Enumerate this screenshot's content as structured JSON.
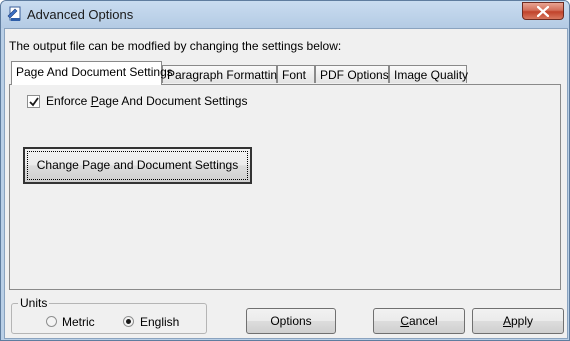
{
  "window": {
    "title": "Advanced Options",
    "icon": "app-document-icon",
    "close_icon": "close-icon"
  },
  "intro_text": "The output file can be modfied by changing the settings below:",
  "tabs": [
    {
      "label": "Page And Document Settings",
      "active": true
    },
    {
      "label": "Paragraph Formatting",
      "active": false
    },
    {
      "label": "Font",
      "active": false
    },
    {
      "label": "PDF Options",
      "active": false
    },
    {
      "label": "Image Quality",
      "active": false
    }
  ],
  "page_settings": {
    "enforce_label_pre": "Enforce ",
    "enforce_label_mnemonic": "P",
    "enforce_label_post": "age And Document Settings",
    "enforce_checked": true,
    "change_button_label": "Change Page and Document Settings"
  },
  "units": {
    "legend": "Units",
    "metric_label": "Metric",
    "english_label": "English",
    "selected": "English"
  },
  "buttons": {
    "options": "Options",
    "cancel_mnemonic": "C",
    "cancel_rest": "ancel",
    "apply_mnemonic": "A",
    "apply_rest": "pply"
  },
  "colors": {
    "title_bar": "#b9cfe6",
    "close_button": "#c1432b",
    "client_bg": "#f0f0f0"
  }
}
